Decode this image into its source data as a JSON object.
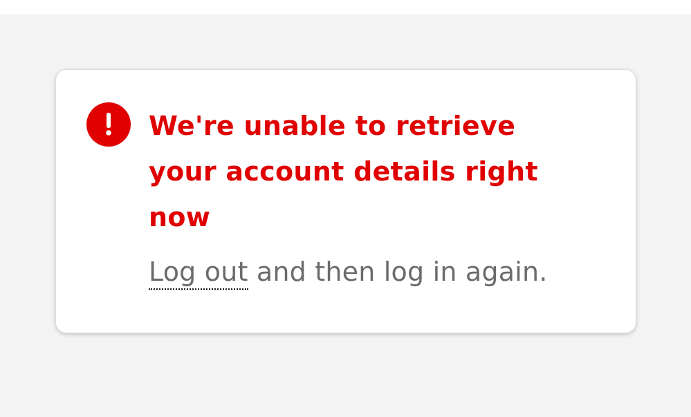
{
  "error": {
    "icon": "exclamation-circle-icon",
    "title": "We're unable to retrieve your account details right now",
    "message": {
      "link_text": "Log out",
      "rest_text": " and then log in again."
    }
  },
  "colors": {
    "accent_red": "#e00000",
    "text_gray": "#6b6b6b",
    "page_background": "#f3f3f3"
  }
}
